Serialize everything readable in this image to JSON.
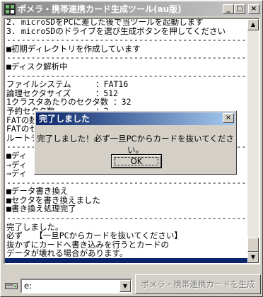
{
  "window": {
    "title": "ポメラ・携帯連携カード生成ツール(au版)",
    "min_label": "_",
    "max_label": "□",
    "close_label": "×"
  },
  "log_lines": [
    "2. microSDをPCに差した後で当ツールを起動します",
    "3. microSDのドライブを選び生成ボタンを押してください",
    "----------------------------------------------------",
    "■初期ディレクトリを作成しています",
    "----------------------------------------------------",
    "■ディスク解析中",
    "----------------------------------------------------",
    "ファイルシステム　　　：FAT16",
    "論理セクタサイズ　　　：512",
    "1クラスタあたりのセクタ数 ：32",
    "予約セクタ数　　　　　：2",
    "FATの数",
    "FATのセ",
    "ルートデ",
    "----------------------------------------------------",
    "■ディ",
    "→ディ",
    "→ディ",
    "----------------------------------------------------",
    "■データ書き換え",
    "■セクタを書き換えました",
    "■書き換え処理完了",
    "----------------------------------------------------",
    "完了しました。",
    "必ず　　【一旦PCからカードを抜いてください】",
    "抜かずにカードへ書き込みを行うとカードの",
    "データが壊れる場合があります。"
  ],
  "dialog": {
    "title": "完了しました",
    "message": "完了しました！必ず一旦PCからカードを抜いてください。",
    "ok_label": "OK",
    "close_label": "×"
  },
  "drive": {
    "selected": "e:"
  },
  "generate_button": {
    "label": "ポメラ・携帯連携カードを生成",
    "enabled": false
  },
  "colors": {
    "titlebar_active": "#0a246a",
    "titlebar_inactive": "#8a8a8a",
    "face": "#d4d0c8"
  }
}
